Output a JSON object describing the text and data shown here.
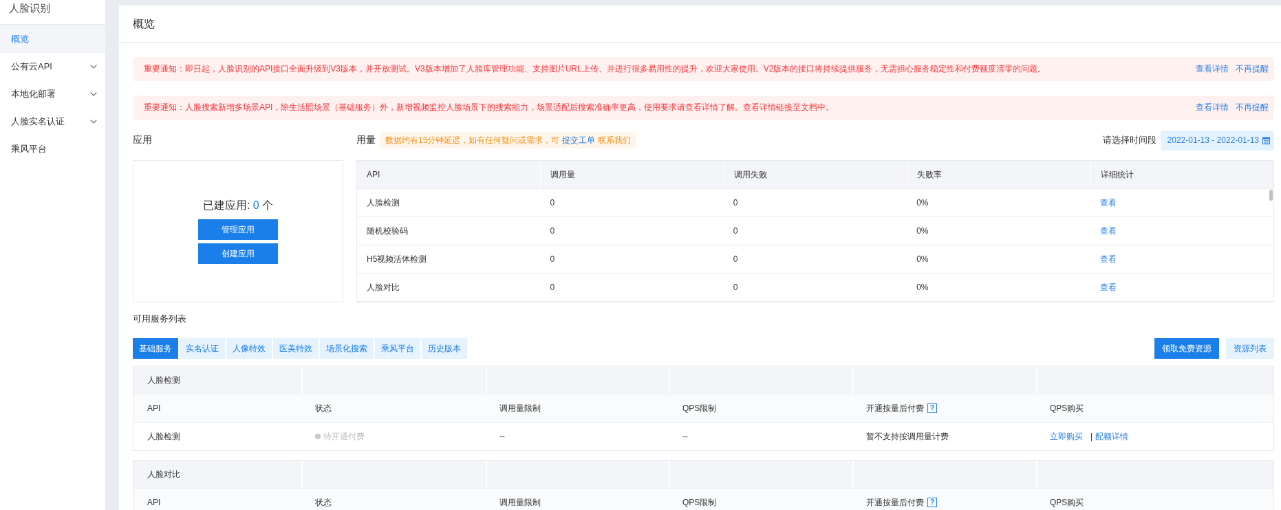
{
  "sidebar": {
    "title": "人脸识别",
    "items": [
      {
        "label": "概览",
        "selected": true,
        "expandable": false
      },
      {
        "label": "公有云API",
        "selected": false,
        "expandable": true
      },
      {
        "label": "本地化部署",
        "selected": false,
        "expandable": true
      },
      {
        "label": "人脸实名认证",
        "selected": false,
        "expandable": true
      },
      {
        "label": "乘风平台",
        "selected": false,
        "expandable": false
      }
    ]
  },
  "page": {
    "title": "概览"
  },
  "notices": [
    {
      "text": "重要通知：即日起，人脸识别的API接口全面升级到V3版本，并开放测试。V3版本增加了人脸库管理功能、支持图片URL上传、并进行很多易用性的提升，欢迎大家使用。V2版本的接口将持续提供服务，无需担心服务稳定性和付费额度清零的问题。",
      "links": [
        "查看详情",
        "不再提醒"
      ]
    },
    {
      "text": "重要通知：人脸搜索新增多场景API，除生活照场景（基础服务）外，新增视频监控人脸场景下的搜索能力，场景适配后搜索准确率更高，使用要求请查看详情了解。查看详情链接至文档中。",
      "links": [
        "查看详情",
        "不再提醒"
      ]
    }
  ],
  "apps": {
    "title": "应用",
    "summary": {
      "label": "已建应用:",
      "count": "0",
      "unit": "个"
    },
    "buttons": [
      "管理应用",
      "创建应用"
    ]
  },
  "usage": {
    "title": "用量",
    "tip": {
      "text": "数据约有15分钟延迟，如有任何疑问或需求，可",
      "links": [
        {
          "label": "提交工单",
          "kind": "primary"
        },
        {
          "label": "联系我们",
          "kind": "warning"
        }
      ]
    },
    "range": {
      "label": "请选择时间段",
      "value": "2022-01-13 - 2022-01-13"
    },
    "table": {
      "columns": [
        "API",
        "调用量",
        "调用失败",
        "失败率",
        "详细统计"
      ],
      "rows": [
        {
          "api": "人脸检测",
          "calls": "0",
          "failures": "0",
          "failure_rate": "0%",
          "details": "查看"
        },
        {
          "api": "随机校验码",
          "calls": "0",
          "failures": "0",
          "failure_rate": "0%",
          "details": "查看"
        },
        {
          "api": "H5视频活体检测",
          "calls": "0",
          "failures": "0",
          "failure_rate": "0%",
          "details": "查看"
        },
        {
          "api": "人脸对比",
          "calls": "0",
          "failures": "0",
          "failure_rate": "0%",
          "details": "查看"
        }
      ]
    }
  },
  "services": {
    "title": "可用服务列表",
    "tabs": [
      {
        "label": "基础服务",
        "selected": true
      },
      {
        "label": "实名认证",
        "selected": false
      },
      {
        "label": "人像特效",
        "selected": false
      },
      {
        "label": "医美特效",
        "selected": false
      },
      {
        "label": "场景化搜索",
        "selected": false
      },
      {
        "label": "乘风平台",
        "selected": false
      },
      {
        "label": "历史版本",
        "selected": false
      }
    ],
    "actions": [
      {
        "label": "领取免费资源",
        "kind": "primary"
      },
      {
        "label": "资源列表",
        "kind": "secondary"
      }
    ],
    "groups": [
      {
        "name": "人脸检测",
        "columns": [
          {
            "label": "API"
          },
          {
            "label": "状态"
          },
          {
            "label": "调用量限制"
          },
          {
            "label": "QPS限制"
          },
          {
            "label": "开通按量后付费",
            "help": "?"
          },
          {
            "label": "QPS购买"
          }
        ],
        "rows": [
          {
            "api": "人脸检测",
            "status": {
              "label": "待开通付费",
              "color": "#c8c8c8"
            },
            "call_limit": "--",
            "qps_limit": "--",
            "billing": "暂不支持按调用量计费",
            "purchase": {
              "links": [
                "立即购买",
                "配额详情"
              ],
              "separator": "|"
            }
          }
        ]
      },
      {
        "name": "人脸对比",
        "columns": [
          {
            "label": "API"
          },
          {
            "label": "状态"
          },
          {
            "label": "调用量限制"
          },
          {
            "label": "QPS限制"
          },
          {
            "label": "开通按量后付费",
            "help": "?"
          },
          {
            "label": "QPS购买"
          }
        ]
      }
    ]
  }
}
